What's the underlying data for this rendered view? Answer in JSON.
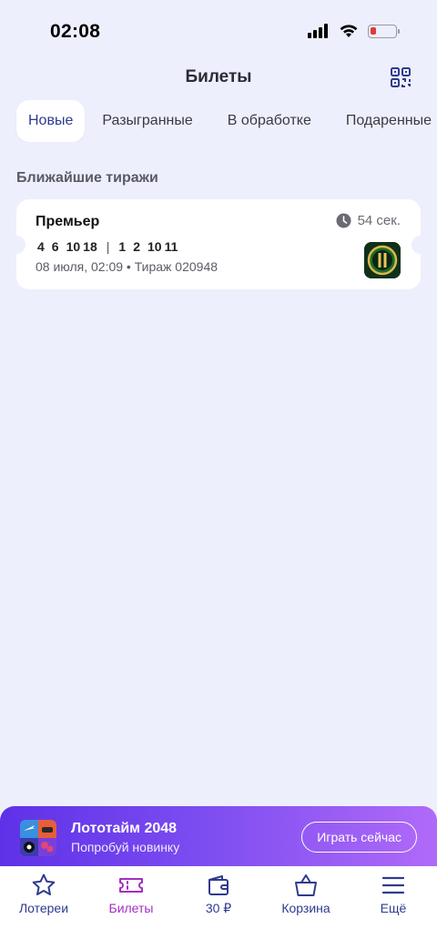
{
  "status_bar": {
    "time": "02:08"
  },
  "header": {
    "title": "Билеты"
  },
  "tabs": [
    {
      "label": "Новые",
      "active": true
    },
    {
      "label": "Разыгранные",
      "active": false
    },
    {
      "label": "В обработке",
      "active": false
    },
    {
      "label": "Подаренные",
      "active": false
    }
  ],
  "section_title": "Ближайшие тиражи",
  "ticket": {
    "name": "Премьер",
    "timer": "54 сек.",
    "numbers_left": [
      "4",
      "6",
      "10",
      "18"
    ],
    "numbers_right": [
      "1",
      "2",
      "10",
      "11"
    ],
    "draw_info": "08 июля, 02:09 • Тираж 020948"
  },
  "promo": {
    "title": "Лототайм 2048",
    "subtitle": "Попробуй новинку",
    "button_label": "Играть сейчас"
  },
  "bottom_nav": [
    {
      "label": "Лотереи",
      "icon": "star-icon"
    },
    {
      "label": "Билеты",
      "icon": "ticket-icon",
      "active": true
    },
    {
      "label": "30 ₽",
      "icon": "wallet-icon"
    },
    {
      "label": "Корзина",
      "icon": "basket-icon"
    },
    {
      "label": "Ещё",
      "icon": "menu-icon"
    }
  ],
  "colors": {
    "background": "#eeeffc",
    "accent_blue": "#2f3a8f",
    "accent_active": "#a22fc2",
    "promo_gradient_start": "#5e31e8",
    "promo_gradient_end": "#b06af8"
  }
}
